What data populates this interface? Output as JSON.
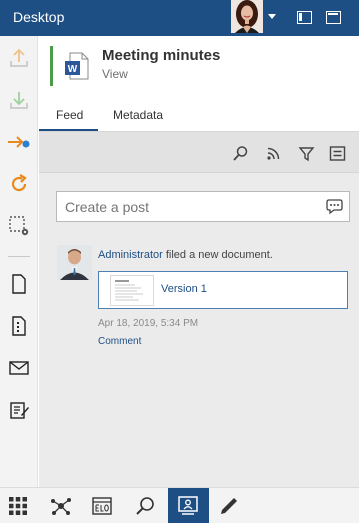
{
  "window": {
    "title": "Desktop"
  },
  "document": {
    "title": "Meeting minutes",
    "subtitle": "View",
    "file_icon_letter": "W"
  },
  "tabs": [
    {
      "label": "Feed",
      "active": true
    },
    {
      "label": "Metadata",
      "active": false
    }
  ],
  "feed": {
    "post_placeholder": "Create a post",
    "entries": [
      {
        "user": "Administrator",
        "action": " filed a new document.",
        "version_label": "Version 1",
        "timestamp": "Apr 18, 2019, 5:34 PM",
        "comment_label": "Comment"
      }
    ]
  },
  "rail_icons": [
    "upload-icon",
    "download-icon",
    "checkin-icon",
    "refresh-icon",
    "select-settings-icon",
    "new-document-icon",
    "new-form-icon",
    "mail-icon",
    "edit-note-icon"
  ],
  "bottom_icons": [
    "apps-grid-icon",
    "network-icon",
    "elo-archive-icon",
    "search-icon",
    "presentation-icon",
    "pen-icon"
  ],
  "colors": {
    "brand": "#1e4f84",
    "accent_orange": "#e8891c",
    "status_green": "#4a9b4a",
    "link": "#1e4f84"
  }
}
